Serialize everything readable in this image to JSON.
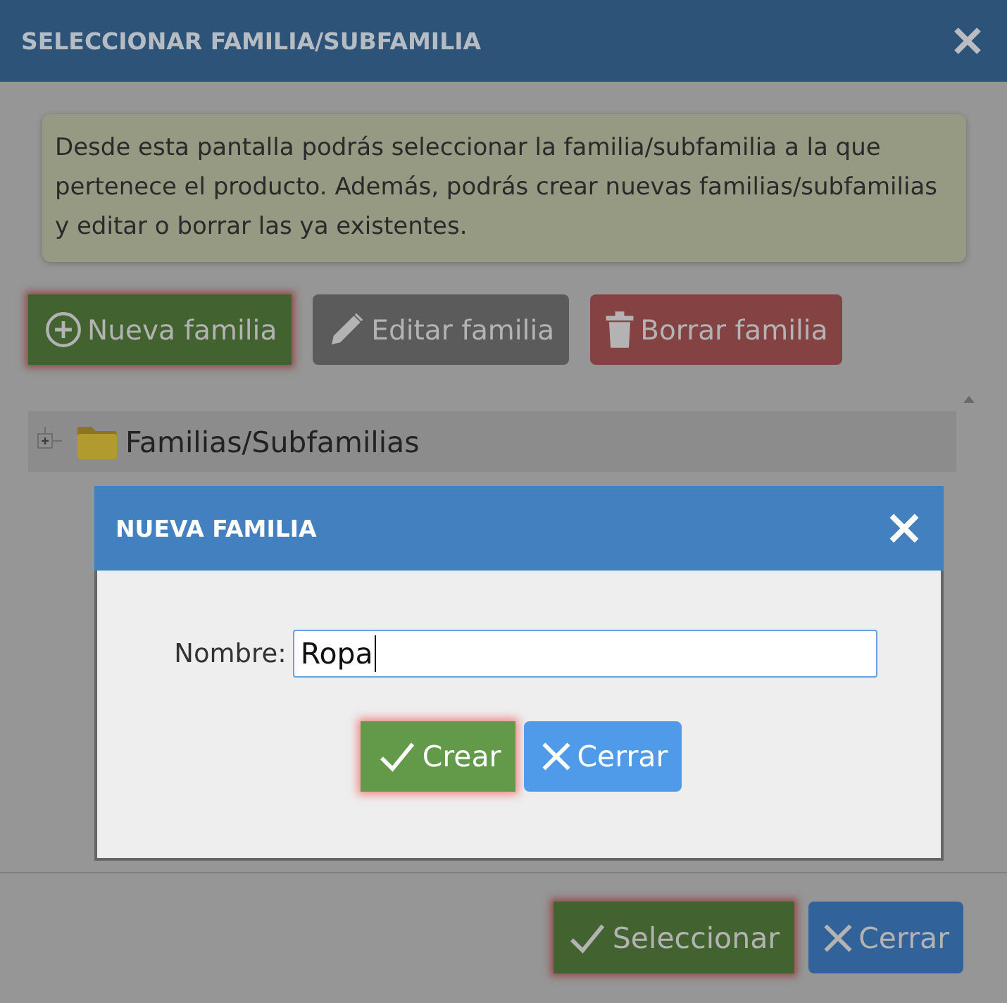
{
  "dialog": {
    "title": "SELECCIONAR FAMILIA/SUBFAMILIA",
    "notice": "Desde esta pantalla podrás seleccionar la familia/subfamilia a la que pertenece el producto. Además, podrás crear nuevas familias/subfamilias y editar o borrar las ya existentes.",
    "toolbar": [
      {
        "kind": "add",
        "label": "Nueva familia",
        "focused": true
      },
      {
        "kind": "edit",
        "label": "Editar familia",
        "focused": false
      },
      {
        "kind": "delete",
        "label": "Borrar familia",
        "focused": false
      }
    ],
    "tree": [
      {
        "label": "Familias/Subfamilias",
        "expanded": false
      }
    ],
    "footer_buttons": [
      {
        "kind": "confirm",
        "label": "Seleccionar",
        "focused": true
      },
      {
        "kind": "close",
        "label": "Cerrar",
        "focused": false
      }
    ]
  },
  "modal": {
    "title": "NUEVA FAMILIA",
    "field": {
      "label": "Nombre:",
      "value": "Ropa"
    },
    "buttons": [
      {
        "kind": "confirm",
        "label": "Crear",
        "focused": true
      },
      {
        "kind": "close",
        "label": "Cerrar",
        "focused": false
      }
    ]
  }
}
